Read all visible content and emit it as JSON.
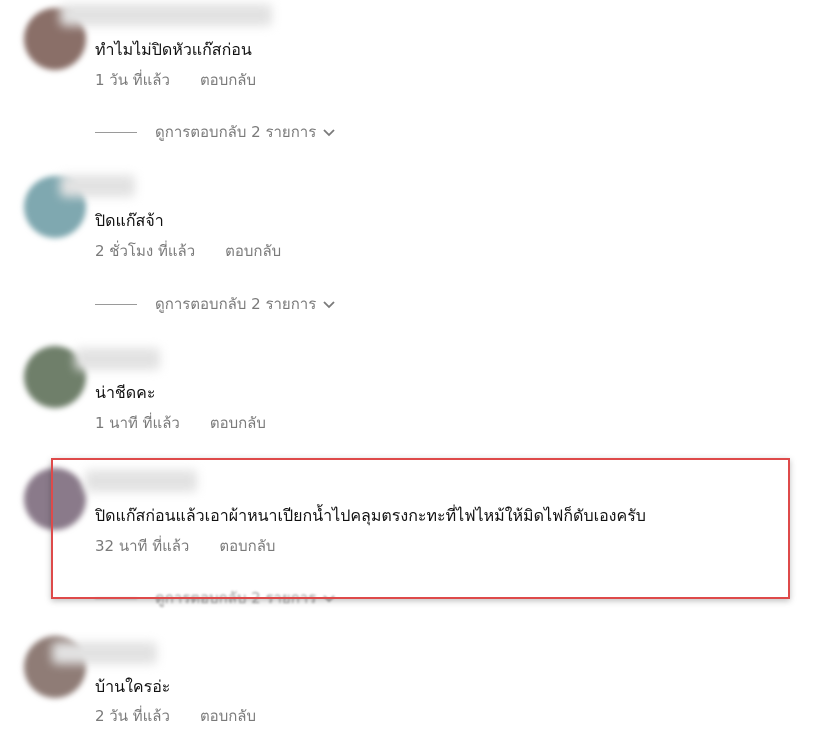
{
  "comments": [
    {
      "text": "ทำไมไม่ปิดหัวแก๊สก่อน",
      "time": "1 วัน ที่แล้ว",
      "reply_label": "ตอบกลับ",
      "replies_label": "ดูการตอบกลับ 2 รายการ",
      "avatar_color": "#8a6f68"
    },
    {
      "text": "ปิดแก๊สจ้า",
      "time": "2 ชั่วโมง ที่แล้ว",
      "reply_label": "ตอบกลับ",
      "replies_label": "ดูการตอบกลับ 2 รายการ",
      "avatar_color": "#7fa8b0"
    },
    {
      "text": "น่าชีดคะ",
      "time": "1 นาที ที่แล้ว",
      "reply_label": "ตอบกลับ",
      "avatar_color": "#6f7f6a"
    },
    {
      "text": "ปิดแก๊สก่อนแล้วเอาผ้าหนาเปียกน้ำไปคลุมตรงกะทะที่ไฟไหม้ให้มิดไฟก็ดับเองครับ",
      "time": "32 นาที ที่แล้ว",
      "reply_label": "ตอบกลับ",
      "replies_label": "ดูการตอบกลับ 2 รายการ",
      "avatar_color": "#8a7a8a"
    },
    {
      "text": "บ้านใครอ่ะ",
      "time": "2 วัน ที่แล้ว",
      "reply_label": "ตอบกลับ",
      "avatar_color": "#8f7c76"
    }
  ],
  "colors": {
    "highlight_border": "#de4a4a",
    "meta_text": "#7a7a7a"
  },
  "icons": {
    "expand": "chevron-down-icon"
  }
}
